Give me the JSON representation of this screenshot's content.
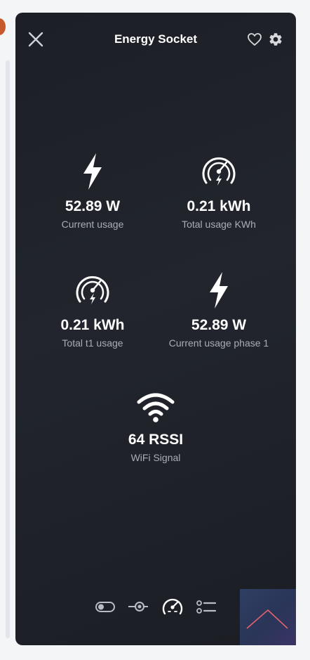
{
  "header": {
    "title": "Energy Socket",
    "close_icon": "close-icon",
    "favorite_icon": "heart-icon",
    "settings_icon": "gear-icon"
  },
  "tiles": [
    {
      "icon": "lightning-icon",
      "value": "52.89 W",
      "label": "Current usage"
    },
    {
      "icon": "gauge-icon",
      "value": "0.21 kWh",
      "label": "Total usage KWh"
    },
    {
      "icon": "gauge-icon",
      "value": "0.21 kWh",
      "label": "Total t1 usage"
    },
    {
      "icon": "lightning-icon",
      "value": "52.89 W",
      "label": "Current usage phase 1"
    },
    {
      "icon": "wifi-icon",
      "value": "64 RSSI",
      "label": "WiFi Signal"
    }
  ],
  "bottom_nav": {
    "items": [
      "toggle-icon",
      "slider-icon",
      "gauge-icon",
      "list-icon"
    ],
    "active": "gauge-icon"
  },
  "colors": {
    "card_background": "#1f2228",
    "text_primary": "#ffffff",
    "text_secondary": "#a9adb5",
    "corner_accent": "#e2636b"
  }
}
